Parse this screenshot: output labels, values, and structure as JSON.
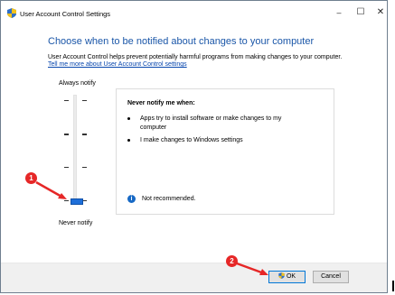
{
  "window": {
    "title": "User Account Control Settings",
    "controls": {
      "minimize": "–",
      "maximize": "☐",
      "close": "✕"
    }
  },
  "main": {
    "heading": "Choose when to be notified about changes to your computer",
    "description": "User Account Control helps prevent potentially harmful programs from making changes to your computer.",
    "link": "Tell me more about User Account Control settings"
  },
  "slider": {
    "top_label": "Always notify",
    "bottom_label": "Never notify",
    "level": 0,
    "levels": 4,
    "accent": "#1e6fd9"
  },
  "info_panel": {
    "title": "Never notify me when:",
    "bullets": [
      "Apps try to install software or make changes to my computer",
      "I make changes to Windows settings"
    ],
    "note": "Not recommended.",
    "note_icon": "info-icon"
  },
  "buttons": {
    "ok": "OK",
    "cancel": "Cancel"
  },
  "annotations": {
    "marker1": "1",
    "marker2": "2",
    "marker_color": "#e62727"
  }
}
